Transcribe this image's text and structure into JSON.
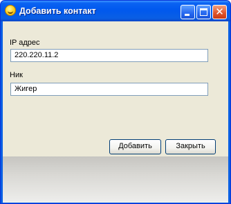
{
  "window": {
    "title": "Добавить контакт",
    "icon": "smiley-icon",
    "controls": {
      "minimize": "minimize-icon",
      "maximize": "maximize-icon",
      "close": "close-icon"
    },
    "colors": {
      "titlebar": "#0058ee",
      "client": "#ece9d8",
      "close_button": "#e2572e"
    }
  },
  "form": {
    "ip_label": "IP адрес",
    "ip_value": "220.220.11.2",
    "nick_label": "Ник",
    "nick_value": "Жигер"
  },
  "buttons": {
    "add_label": "Добавить",
    "close_label": "Закрыть"
  }
}
